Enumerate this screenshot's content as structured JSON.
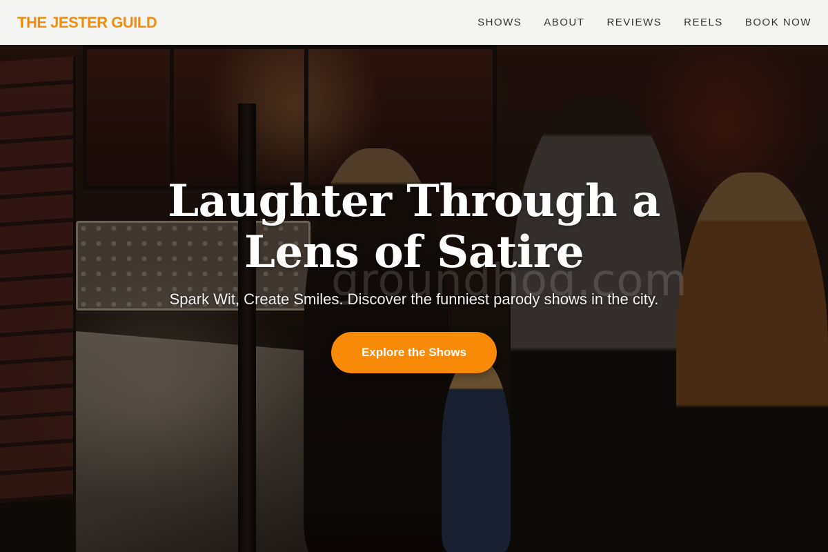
{
  "header": {
    "brand": "THE JESTER GUILD",
    "nav": [
      {
        "label": "SHOWS"
      },
      {
        "label": "ABOUT"
      },
      {
        "label": "REVIEWS"
      },
      {
        "label": "REELS"
      },
      {
        "label": "BOOK NOW"
      }
    ]
  },
  "hero": {
    "title": "Laughter Through a Lens of Satire",
    "subtitle": "Spark Wit, Create Smiles. Discover the funniest parody shows in the city.",
    "cta_label": "Explore the Shows",
    "watermark": "groundhog.com",
    "image_description": "comedy-club-stairway-photo"
  },
  "colors": {
    "brand": "#f18c0c",
    "cta": "#f98a07",
    "header_bg": "#f4f4f3"
  }
}
